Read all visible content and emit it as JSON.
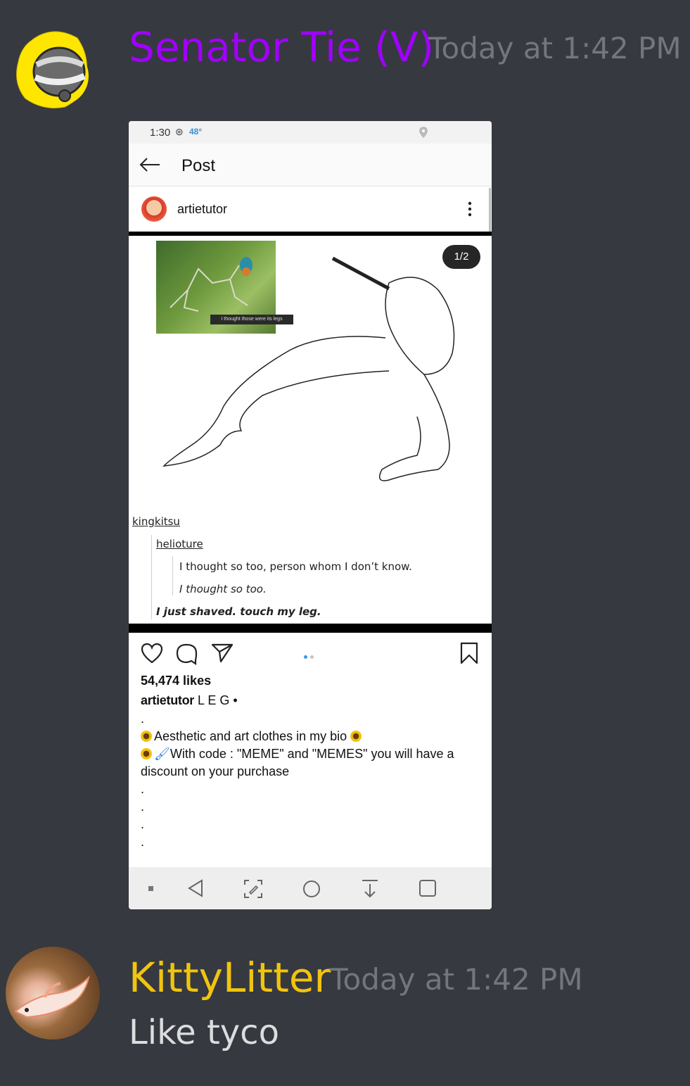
{
  "messages": [
    {
      "username": "Senator Tie (V)",
      "username_color": "#a100ff",
      "timestamp": "Today at 1:42 PM",
      "avatar_icon": "astronaut-helmet-icon"
    },
    {
      "username": "KittyLitter",
      "username_color": "#f1c40f",
      "timestamp": "Today at 1:42 PM",
      "text": "Like tyco",
      "avatar_icon": "fish-photo"
    }
  ],
  "screenshot": {
    "status": {
      "time": "1:30",
      "temp": "48°"
    },
    "header": {
      "title": "Post"
    },
    "post": {
      "username": "artietutor",
      "page_indicator": "1/2",
      "photo_caption": "I thought those were its legs",
      "tumblr": {
        "user1": "kingkitsu",
        "user2": "helioture",
        "line1": "I thought so too, person whom I don’t know.",
        "line2": "I thought so too.",
        "line3": "I just shaved. touch my leg."
      },
      "likes": "54,474 likes",
      "caption_user": "artietutor",
      "caption_text": "L E G •",
      "caption_lines": [
        ".",
        "Aesthetic and art clothes in my bio",
        "With code : \"MEME\" and \"MEMES\" you will have a",
        "discount on your purchase",
        ".",
        ".",
        ".",
        "."
      ]
    }
  },
  "colors": {
    "background": "#36393f",
    "timestamp": "#72767d",
    "message_text": "#dcddde",
    "dot_active": "#3897f0"
  }
}
